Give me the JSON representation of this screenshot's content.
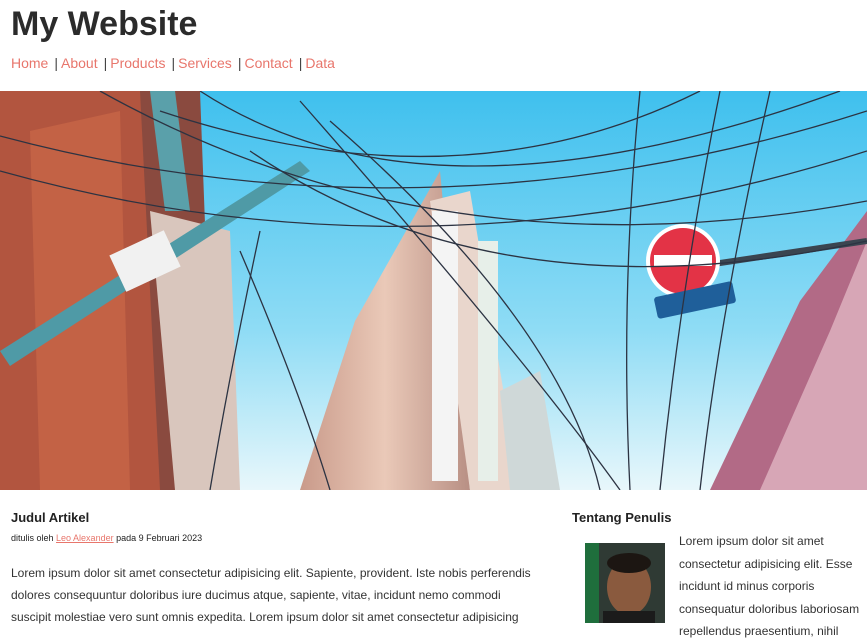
{
  "site": {
    "title": "My Website"
  },
  "nav": {
    "items": [
      {
        "label": "Home"
      },
      {
        "label": "About"
      },
      {
        "label": "Products"
      },
      {
        "label": "Services"
      },
      {
        "label": "Contact"
      },
      {
        "label": "Data"
      }
    ],
    "separator": "|"
  },
  "article": {
    "title": "Judul Artikel",
    "meta_prefix": "ditulis oleh ",
    "author": "Leo Alexander",
    "meta_suffix": " pada 9 Februari 2023",
    "body": "Lorem ipsum dolor sit amet consectetur adipisicing elit. Sapiente, provident. Iste nobis perferendis dolores consequuntur doloribus iure ducimus atque, sapiente, vitae, incidunt nemo commodi suscipit molestiae vero sunt omnis expedita. Lorem ipsum dolor sit amet consectetur adipisicing"
  },
  "sidebar": {
    "title": "Tentang Penulis",
    "bio": "Lorem ipsum dolor sit amet consectetur adipisicing elit. Esse incidunt id minus corporis consequatur doloribus laboriosam repellendus praesentium, nihil"
  },
  "colors": {
    "link": "#e8766c",
    "sky": "#5ecbf0"
  }
}
